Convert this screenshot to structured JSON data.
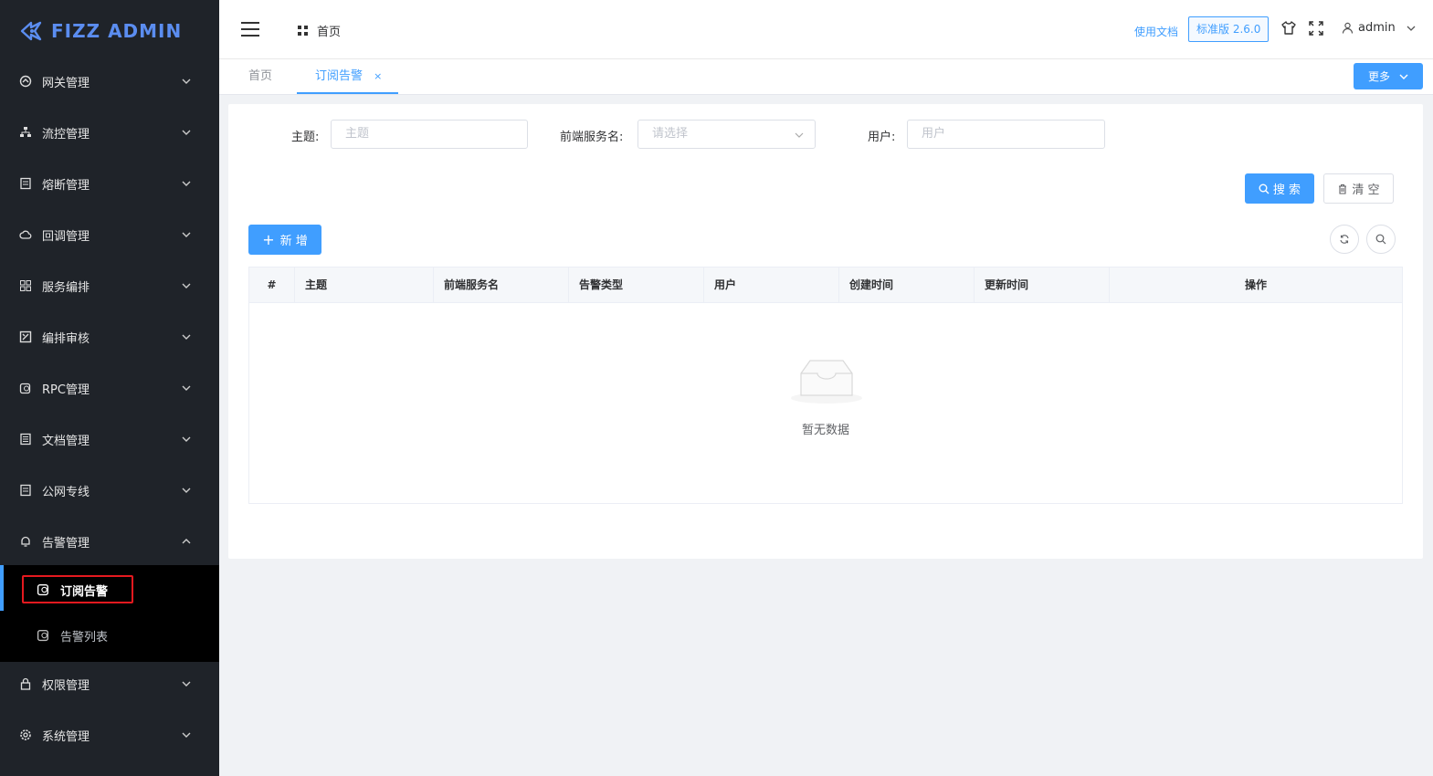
{
  "app": {
    "logo_text": "FIZZ ADMIN"
  },
  "sidebar": {
    "items": [
      {
        "label": "网关管理",
        "icon": "gateway-icon"
      },
      {
        "label": "流控管理",
        "icon": "sitemap-icon"
      },
      {
        "label": "熔断管理",
        "icon": "document-icon"
      },
      {
        "label": "回调管理",
        "icon": "cloud-icon"
      },
      {
        "label": "服务编排",
        "icon": "grid-icon"
      },
      {
        "label": "编排审核",
        "icon": "review-icon"
      },
      {
        "label": "RPC管理",
        "icon": "shield-icon"
      },
      {
        "label": "文档管理",
        "icon": "doc-list-icon"
      },
      {
        "label": "公网专线",
        "icon": "document-icon"
      },
      {
        "label": "告警管理",
        "icon": "bell-icon"
      },
      {
        "label": "权限管理",
        "icon": "lock-icon"
      },
      {
        "label": "系统管理",
        "icon": "gear-icon"
      }
    ],
    "sub_items": [
      {
        "label": "订阅告警",
        "icon": "shield-icon"
      },
      {
        "label": "告警列表",
        "icon": "shield-icon"
      }
    ]
  },
  "header": {
    "breadcrumb": "首页",
    "doc_link": "使用文档",
    "version": "标准版 2.6.0",
    "user": "admin"
  },
  "tabs": {
    "home": "首页",
    "active": "订阅告警",
    "close": "×",
    "more": "更多"
  },
  "filters": {
    "topic_label": "主题:",
    "topic_placeholder": "主题",
    "service_label": "前端服务名:",
    "service_placeholder": "请选择",
    "user_label": "用户:",
    "user_placeholder": "用户"
  },
  "buttons": {
    "search": "搜 索",
    "clear": "清 空",
    "add": "新 增"
  },
  "table": {
    "columns": [
      "#",
      "主题",
      "前端服务名",
      "告警类型",
      "用户",
      "创建时间",
      "更新时间",
      "操作"
    ],
    "empty_text": "暂无数据"
  },
  "colors": {
    "primary": "#409eff",
    "sidebar_bg": "#1f2329",
    "highlight": "#e5191f"
  }
}
